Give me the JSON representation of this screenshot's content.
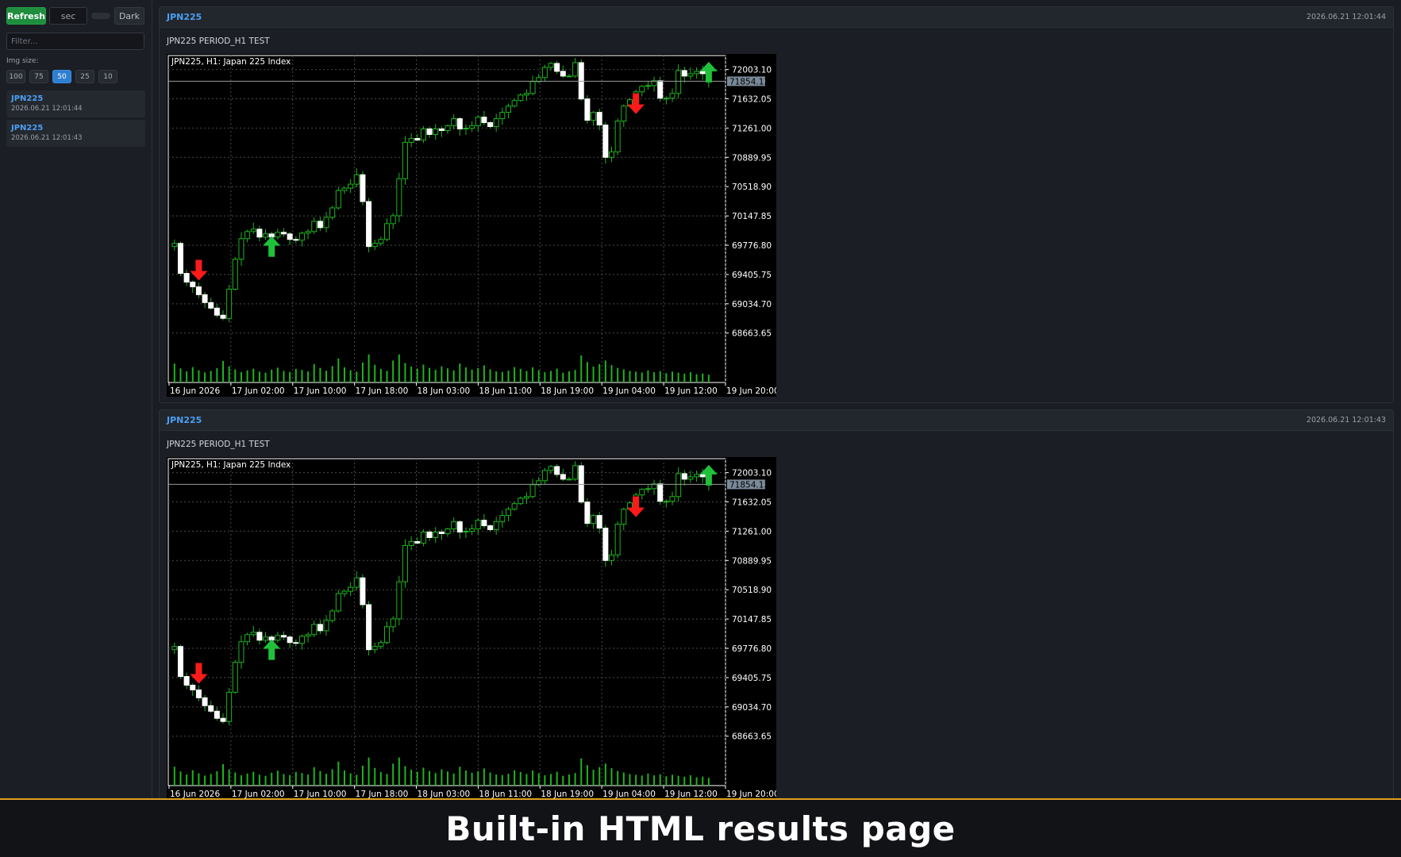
{
  "sidebar": {
    "refresh_label": "Refresh",
    "interval_value": "sec",
    "theme_label": "Dark",
    "filter_placeholder": "Filter...",
    "img_size_label": "Img size:",
    "sizes": [
      "100",
      "75",
      "50",
      "25",
      "10"
    ],
    "active_size": "50",
    "items": [
      {
        "name": "JPN225",
        "time": "2026.06.21 12:01:44"
      },
      {
        "name": "JPN225",
        "time": "2026.06.21 12:01:43"
      }
    ]
  },
  "results": [
    {
      "title": "JPN225",
      "time": "2026.06.21 12:01:44",
      "subtitle": "JPN225 PERIOD_H1 TEST"
    },
    {
      "title": "JPN225",
      "time": "2026.06.21 12:01:43",
      "subtitle": "JPN225 PERIOD_H1 TEST"
    }
  ],
  "banner": {
    "text": "Built-in HTML results page"
  },
  "colors": {
    "accent": "#4c9ff1",
    "refresh": "#1e8e3e",
    "bull": "#ffffff",
    "bear_wick": "#1db51d",
    "arrow_up": "#1fc13a",
    "arrow_down": "#ff1a1a",
    "banner_border": "#e0a020"
  },
  "chart_data": {
    "type": "candlestick",
    "title": "JPN225, H1:  Japan 225 Index",
    "y_ticks": [
      72003.1,
      71632.05,
      71261.0,
      70889.95,
      70518.9,
      70147.85,
      69776.8,
      69405.75,
      69034.7,
      68663.65
    ],
    "current_price": 71854.13,
    "x_ticks": [
      "16 Jun 2026",
      "17 Jun 02:00",
      "17 Jun 10:00",
      "17 Jun 18:00",
      "18 Jun 03:00",
      "18 Jun 11:00",
      "18 Jun 19:00",
      "19 Jun 04:00",
      "19 Jun 12:00",
      "19 Jun 20:00"
    ],
    "ylim": [
      68480,
      72180
    ],
    "closes": [
      69800,
      69420,
      69310,
      69250,
      69150,
      69050,
      68980,
      68890,
      68850,
      69220,
      69600,
      69860,
      69950,
      69980,
      69880,
      69920,
      69880,
      69940,
      69920,
      69850,
      69840,
      69930,
      69950,
      70080,
      70000,
      70130,
      70250,
      70470,
      70500,
      70550,
      70670,
      70330,
      69760,
      69800,
      69850,
      70050,
      70150,
      70620,
      71080,
      71130,
      71110,
      71250,
      71180,
      71250,
      71230,
      71290,
      71380,
      71250,
      71260,
      71290,
      71400,
      71330,
      71280,
      71380,
      71460,
      71540,
      71610,
      71680,
      71700,
      71850,
      71900,
      72030,
      72080,
      71980,
      71920,
      71920,
      72090,
      71630,
      71360,
      71460,
      71300,
      70890,
      70960,
      71350,
      71540,
      71620,
      71720,
      71790,
      71800,
      71860,
      71640,
      71640,
      71700,
      71990,
      71920,
      71950,
      71980,
      71950,
      71860
    ],
    "volume": [
      0.62,
      0.43,
      0.31,
      0.48,
      0.36,
      0.27,
      0.33,
      0.44,
      0.72,
      0.51,
      0.39,
      0.28,
      0.35,
      0.42,
      0.3,
      0.26,
      0.38,
      0.46,
      0.33,
      0.29,
      0.41,
      0.37,
      0.31,
      0.6,
      0.45,
      0.34,
      0.52,
      0.82,
      0.47,
      0.36,
      0.3,
      0.66,
      0.98,
      0.57,
      0.41,
      0.33,
      0.74,
      0.98,
      0.64,
      0.5,
      0.42,
      0.58,
      0.45,
      0.37,
      0.51,
      0.43,
      0.35,
      0.62,
      0.47,
      0.38,
      0.44,
      0.55,
      0.39,
      0.31,
      0.29,
      0.34,
      0.48,
      0.41,
      0.33,
      0.47,
      0.36,
      0.28,
      0.33,
      0.42,
      0.26,
      0.31,
      0.37,
      0.94,
      0.68,
      0.5,
      0.6,
      0.74,
      0.56,
      0.45,
      0.39,
      0.33,
      0.3,
      0.27,
      0.35,
      0.28,
      0.32,
      0.24,
      0.3,
      0.26,
      0.22,
      0.28,
      0.2,
      0.23,
      0.18
    ],
    "signals": [
      {
        "type": "sell",
        "bar": 4,
        "price": 69470
      },
      {
        "type": "buy",
        "bar": 16,
        "price": 69750
      },
      {
        "type": "sell",
        "bar": 76,
        "price": 71580
      },
      {
        "type": "buy",
        "bar": 93,
        "price": 71960
      }
    ]
  }
}
